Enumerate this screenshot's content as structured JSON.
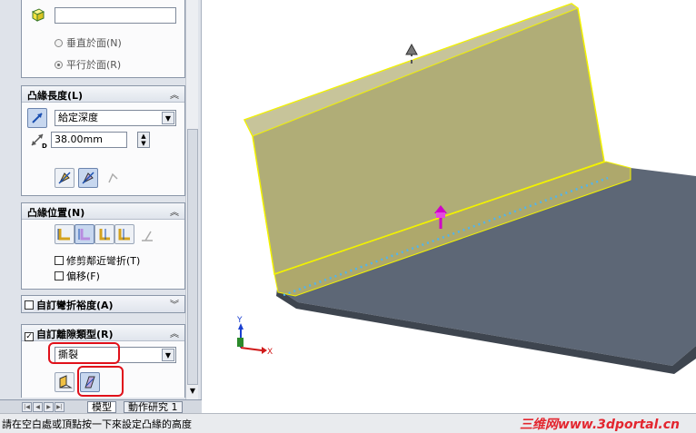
{
  "panel": {
    "face_group": {
      "face_input_value": "",
      "radio_perpendicular": "垂直於面(N)",
      "radio_parallel": "平行於面(R)",
      "selected": "parallel"
    },
    "length_group": {
      "title": "凸緣長度(L)",
      "end_condition": "給定深度",
      "depth_value": "38.00mm",
      "depth_label_sub": "D"
    },
    "position_group": {
      "title": "凸緣位置(N)",
      "trim_side_bends": "修剪鄰近彎折(T)",
      "offset": "偏移(F)"
    },
    "bend_allowance_group": {
      "title": "自訂彎折裕度(A)",
      "checked": false
    },
    "relief_group": {
      "title": "自訂離隙類型(R)",
      "checked": true,
      "relief_type": "撕裂"
    }
  },
  "tabs": [
    "模型",
    "動作研究 1"
  ],
  "status_text": "請在空白處或頂點按一下來設定凸緣的高度",
  "watermark": "三维网www.3dportal.cn",
  "triad": {
    "x_label": "X",
    "y_label": "Y"
  },
  "colors": {
    "flange_fill": "#b0ad77",
    "flange_outline": "#f2f200",
    "plate": "#5d6776",
    "highlight_box": "#e0101a",
    "arrow_magenta": "#d000c8"
  }
}
